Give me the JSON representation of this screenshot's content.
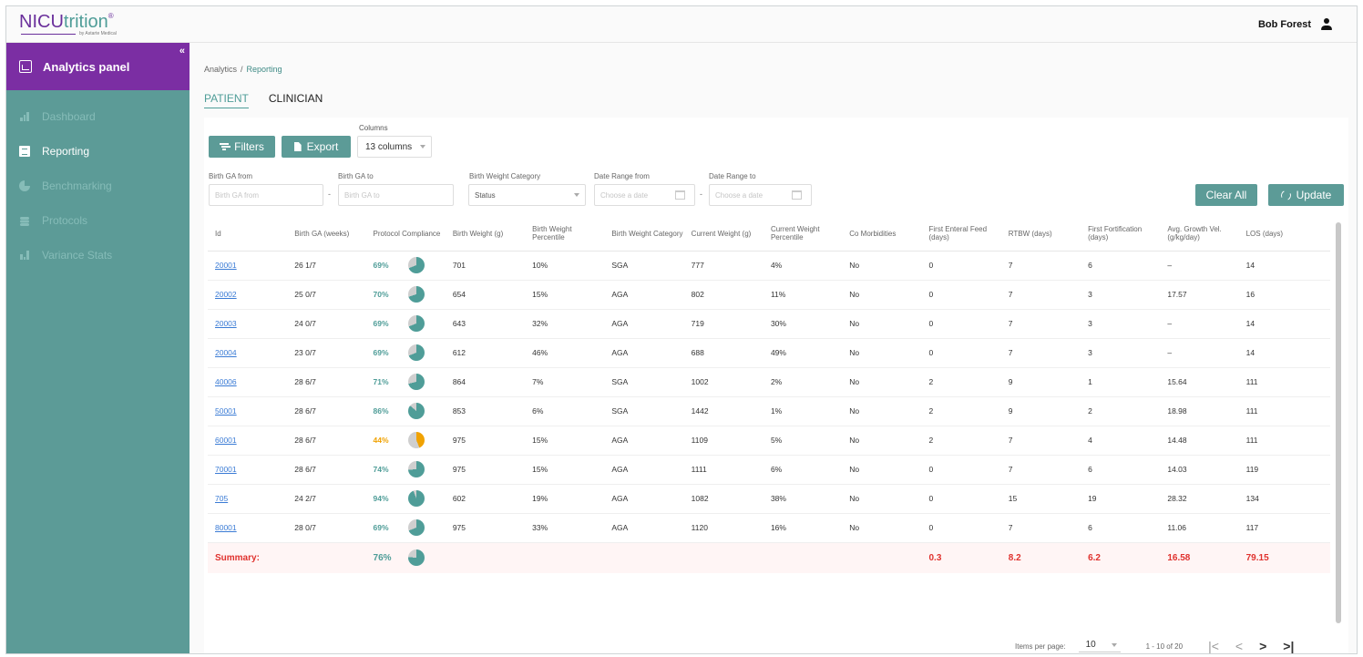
{
  "app": {
    "logo_main": "NICU",
    "logo_accent": "trition",
    "logo_reg": "®",
    "logo_by": "by Astarte Medical",
    "user_name": "Bob Forest"
  },
  "sidebar": {
    "collapse": "«",
    "active_label": "Analytics panel",
    "items": [
      {
        "label": "Dashboard"
      },
      {
        "label": "Reporting"
      },
      {
        "label": "Benchmarking"
      },
      {
        "label": "Protocols"
      },
      {
        "label": "Variance Stats"
      }
    ]
  },
  "breadcrumb": {
    "root": "Analytics",
    "sep": "/",
    "current": "Reporting"
  },
  "tabs": [
    {
      "label": "PATIENT"
    },
    {
      "label": "CLINICIAN"
    }
  ],
  "toolbar": {
    "filters_label": "Filters",
    "export_label": "Export",
    "columns_label": "Columns",
    "columns_value": "13 columns",
    "clear_label": "Clear All",
    "update_label": "Update"
  },
  "filters": {
    "ga_from_label": "Birth GA from",
    "ga_from_placeholder": "Birth GA from",
    "ga_to_label": "Birth GA to",
    "ga_to_placeholder": "Birth GA to",
    "bw_label": "Birth Weight Category",
    "bw_value": "Status",
    "date_from_label": "Date Range from",
    "date_from_placeholder": "Choose a date",
    "date_to_label": "Date Range to",
    "date_to_placeholder": "Choose a date",
    "dash": "-"
  },
  "table": {
    "headers": [
      "Id",
      "Birth GA (weeks)",
      "Protocol Compliance",
      "Birth Weight (g)",
      "Birth Weight Percentile",
      "Birth Weight Category",
      "Current Weight (g)",
      "Current Weight Percentile",
      "Co Morbidities",
      "First Enteral Feed (days)",
      "RTBW (days)",
      "First Fortification (days)",
      "Avg. Growth Vel. (g/kg/day)",
      "LOS (days)"
    ],
    "rows": [
      {
        "id": "20001",
        "ga": "26 1/7",
        "comp": "69%",
        "comp_value": 69,
        "bw": "701",
        "bwp": "10%",
        "bwc": "SGA",
        "cw": "777",
        "cwp": "4%",
        "cm": "No",
        "fef": "0",
        "rtbw": "7",
        "ff": "6",
        "agv": "–",
        "los": "14"
      },
      {
        "id": "20002",
        "ga": "25 0/7",
        "comp": "70%",
        "comp_value": 70,
        "bw": "654",
        "bwp": "15%",
        "bwc": "AGA",
        "cw": "802",
        "cwp": "11%",
        "cm": "No",
        "fef": "0",
        "rtbw": "7",
        "ff": "3",
        "agv": "17.57",
        "los": "16"
      },
      {
        "id": "20003",
        "ga": "24 0/7",
        "comp": "69%",
        "comp_value": 69,
        "bw": "643",
        "bwp": "32%",
        "bwc": "AGA",
        "cw": "719",
        "cwp": "30%",
        "cm": "No",
        "fef": "0",
        "rtbw": "7",
        "ff": "3",
        "agv": "–",
        "los": "14"
      },
      {
        "id": "20004",
        "ga": "23 0/7",
        "comp": "69%",
        "comp_value": 69,
        "bw": "612",
        "bwp": "46%",
        "bwc": "AGA",
        "cw": "688",
        "cwp": "49%",
        "cm": "No",
        "fef": "0",
        "rtbw": "7",
        "ff": "3",
        "agv": "–",
        "los": "14"
      },
      {
        "id": "40006",
        "ga": "28 6/7",
        "comp": "71%",
        "comp_value": 71,
        "bw": "864",
        "bwp": "7%",
        "bwc": "SGA",
        "cw": "1002",
        "cwp": "2%",
        "cm": "No",
        "fef": "2",
        "rtbw": "9",
        "ff": "1",
        "agv": "15.64",
        "los": "111"
      },
      {
        "id": "50001",
        "ga": "28 6/7",
        "comp": "86%",
        "comp_value": 86,
        "bw": "853",
        "bwp": "6%",
        "bwc": "SGA",
        "cw": "1442",
        "cwp": "1%",
        "cm": "No",
        "fef": "2",
        "rtbw": "9",
        "ff": "2",
        "agv": "18.98",
        "los": "111"
      },
      {
        "id": "60001",
        "ga": "28 6/7",
        "comp": "44%",
        "comp_value": 44,
        "bw": "975",
        "bwp": "15%",
        "bwc": "AGA",
        "cw": "1109",
        "cwp": "5%",
        "cm": "No",
        "fef": "2",
        "rtbw": "7",
        "ff": "4",
        "agv": "14.48",
        "los": "111"
      },
      {
        "id": "70001",
        "ga": "28 6/7",
        "comp": "74%",
        "comp_value": 74,
        "bw": "975",
        "bwp": "15%",
        "bwc": "AGA",
        "cw": "1111",
        "cwp": "6%",
        "cm": "No",
        "fef": "0",
        "rtbw": "7",
        "ff": "6",
        "agv": "14.03",
        "los": "119"
      },
      {
        "id": "705",
        "ga": "24 2/7",
        "comp": "94%",
        "comp_value": 94,
        "bw": "602",
        "bwp": "19%",
        "bwc": "AGA",
        "cw": "1082",
        "cwp": "38%",
        "cm": "No",
        "fef": "0",
        "rtbw": "15",
        "ff": "19",
        "agv": "28.32",
        "los": "134"
      },
      {
        "id": "80001",
        "ga": "28 0/7",
        "comp": "69%",
        "comp_value": 69,
        "bw": "975",
        "bwp": "33%",
        "bwc": "AGA",
        "cw": "1120",
        "cwp": "16%",
        "cm": "No",
        "fef": "0",
        "rtbw": "7",
        "ff": "6",
        "agv": "11.06",
        "los": "117"
      }
    ],
    "summary": {
      "label": "Summary:",
      "comp": "76%",
      "comp_value": 76,
      "fef": "0.3",
      "rtbw": "8.2",
      "ff": "6.2",
      "agv": "16.58",
      "los": "79.15"
    }
  },
  "pager": {
    "items_label": "Items per page:",
    "items_value": "10",
    "range": "1 - 10 of 20",
    "first": "|<",
    "prev": "<",
    "next": ">",
    "last": ">|"
  },
  "colors": {
    "teal": "#5c9b97",
    "purple": "#7b2ea3",
    "ok": "#4f9d98",
    "warn": "#f0a202",
    "summary_red": "#e0322e"
  }
}
